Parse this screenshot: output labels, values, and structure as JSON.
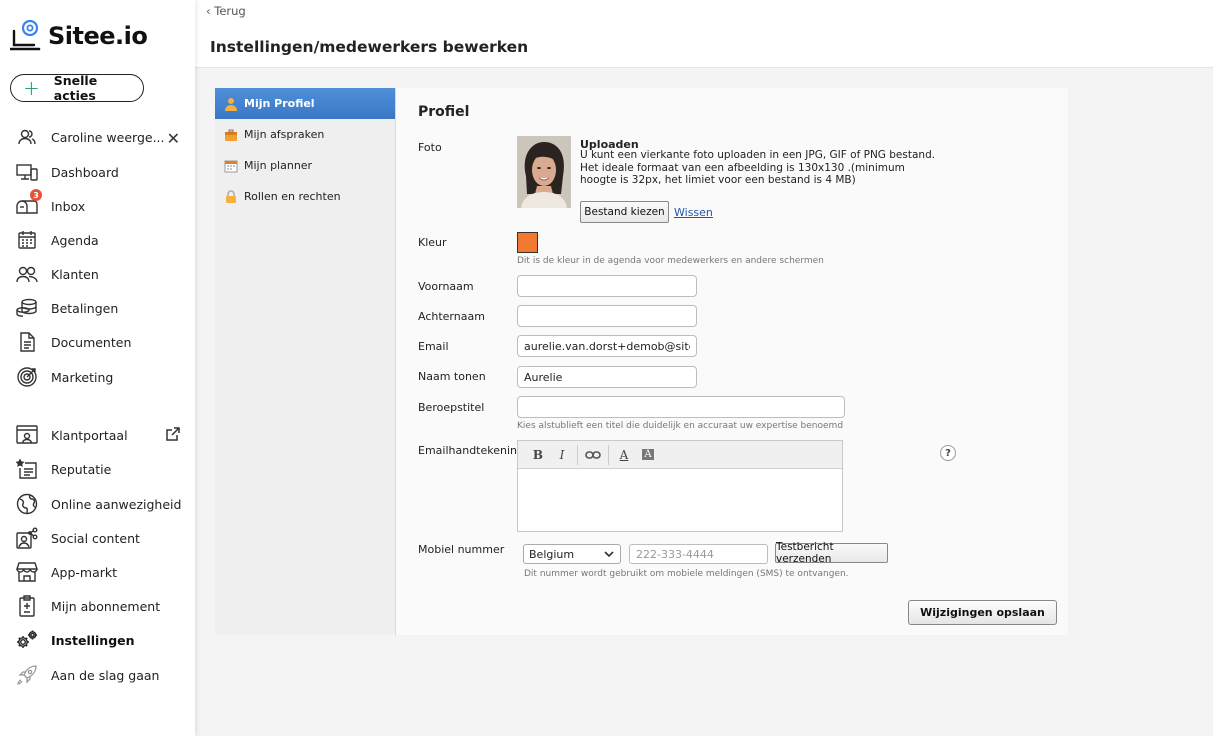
{
  "brand": {
    "name": "Sitee.io",
    "accent": "#3b82f6"
  },
  "quick_actions": {
    "label": "Snelle acties"
  },
  "sidebar": {
    "items": [
      {
        "label": "Caroline weerge...",
        "icon": "users-icon"
      },
      {
        "label": "Dashboard",
        "icon": "devices-icon"
      },
      {
        "label": "Inbox",
        "icon": "mailbox-icon",
        "badge": "3"
      },
      {
        "label": "Agenda",
        "icon": "calendar-icon"
      },
      {
        "label": "Klanten",
        "icon": "people-icon"
      },
      {
        "label": "Betalingen",
        "icon": "coins-icon"
      },
      {
        "label": "Documenten",
        "icon": "document-icon"
      },
      {
        "label": "Marketing",
        "icon": "target-icon"
      },
      {
        "label": "Klantportaal",
        "icon": "portal-icon"
      },
      {
        "label": "Reputatie",
        "icon": "star-list-icon"
      },
      {
        "label": "Online aanwezigheid",
        "icon": "globe-icon"
      },
      {
        "label": "Social content",
        "icon": "share-image-icon"
      },
      {
        "label": "App-markt",
        "icon": "store-icon"
      },
      {
        "label": "Mijn abonnement",
        "icon": "clipboard-icon"
      },
      {
        "label": "Instellingen",
        "icon": "gears-icon"
      },
      {
        "label": "Aan de slag gaan",
        "icon": "rocket-icon"
      }
    ]
  },
  "header": {
    "back_label": "Terug",
    "title": "Instellingen/medewerkers bewerken"
  },
  "settings_menu": {
    "items": [
      {
        "label": "Mijn Profiel",
        "active": true
      },
      {
        "label": "Mijn afspraken"
      },
      {
        "label": "Mijn planner"
      },
      {
        "label": "Rollen en rechten"
      }
    ]
  },
  "profile": {
    "section_title": "Profiel",
    "photo_label": "Foto",
    "upload_title": "Uploaden",
    "upload_desc": "U kunt een vierkante foto uploaden in een JPG, GIF of PNG bestand. Het ideale formaat van een afbeelding is 130x130 .(minimum hoogte is 32px, het limiet voor een bestand is 4 MB)",
    "choose_file_label": "Bestand kiezen",
    "remove_label": "Wissen",
    "color_label": "Kleur",
    "color_value": "#f07830",
    "color_hint": "Dit is de kleur in de agenda voor medewerkers en andere schermen",
    "first_name_label": "Voornaam",
    "first_name_value": "",
    "last_name_label": "Achternaam",
    "last_name_value": "",
    "email_label": "Email",
    "email_value": "aurelie.van.dorst+demob@sitee.io",
    "display_name_label": "Naam tonen",
    "display_name_value": "Aurelie",
    "job_title_label": "Beroepstitel",
    "job_title_value": "",
    "job_title_hint": "Kies alstublieft een titel die duidelijk en accuraat uw expertise benoemd",
    "signature_label": "Emailhandtekening",
    "help_label": "?",
    "mobile_label": "Mobiel nummer",
    "country_value": "Belgium",
    "phone_placeholder": "222-333-4444",
    "test_sms_label": "Testbericht verzenden",
    "mobile_hint": "Dit nummer wordt gebruikt om mobiele meldingen (SMS) te ontvangen.",
    "save_label": "Wijzigingen opslaan"
  }
}
